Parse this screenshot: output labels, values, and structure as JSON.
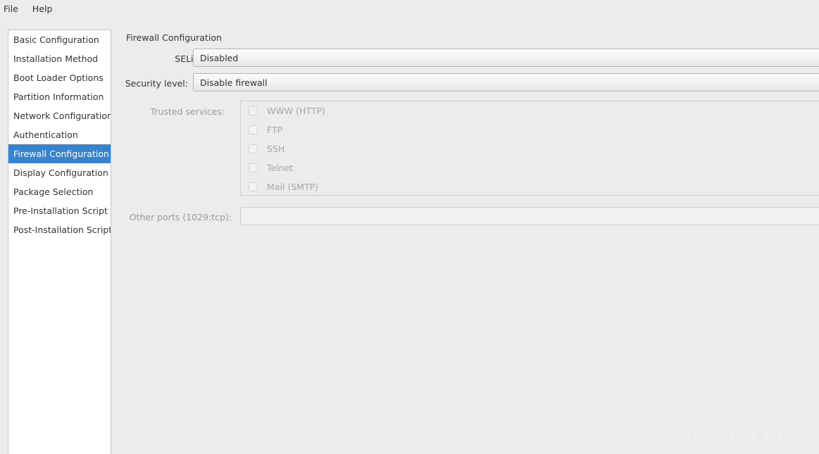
{
  "menubar": {
    "items": [
      {
        "label": "File"
      },
      {
        "label": "Help"
      }
    ]
  },
  "sidebar": {
    "items": [
      {
        "label": "Basic Configuration",
        "selected": false
      },
      {
        "label": "Installation Method",
        "selected": false
      },
      {
        "label": "Boot Loader Options",
        "selected": false
      },
      {
        "label": "Partition Information",
        "selected": false
      },
      {
        "label": "Network Configuration",
        "selected": false
      },
      {
        "label": "Authentication",
        "selected": false
      },
      {
        "label": "Firewall Configuration",
        "selected": true
      },
      {
        "label": "Display Configuration",
        "selected": false
      },
      {
        "label": "Package Selection",
        "selected": false
      },
      {
        "label": "Pre-Installation Script",
        "selected": false
      },
      {
        "label": "Post-Installation Script",
        "selected": false
      }
    ],
    "selected_color": "#3584d3"
  },
  "main": {
    "title": "Firewall Configuration",
    "selinux": {
      "label": "SELinux:",
      "value": "Disabled"
    },
    "security_level": {
      "label": "Security level:",
      "value": "Disable firewall"
    },
    "trusted_services": {
      "label": "Trusted services:",
      "items": [
        {
          "label": "WWW (HTTP)",
          "checked": false
        },
        {
          "label": "FTP",
          "checked": false
        },
        {
          "label": "SSH",
          "checked": false
        },
        {
          "label": "Telnet",
          "checked": false
        },
        {
          "label": "Mail (SMTP)",
          "checked": false
        }
      ]
    },
    "other_ports": {
      "label": "Other ports (1029:tcp):",
      "value": "",
      "placeholder": ""
    }
  },
  "watermark": {
    "text": "https://blog.csdn.net/qq_45425035"
  }
}
